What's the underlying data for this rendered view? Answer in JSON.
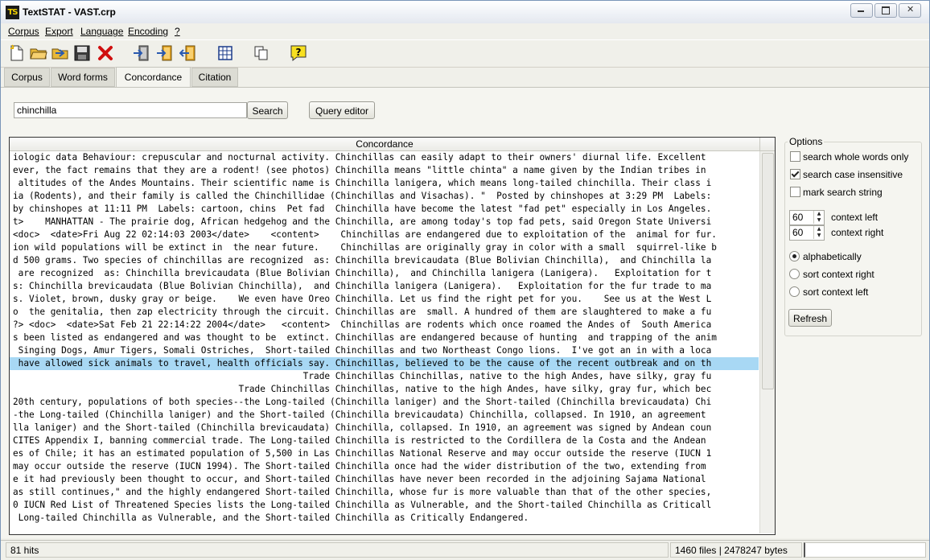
{
  "window": {
    "title": "TextSTAT - VAST.crp",
    "app_icon_text": "TS"
  },
  "menu": [
    "Corpus",
    "Export",
    "Language",
    "Encoding",
    "?"
  ],
  "toolbar": {
    "icons": [
      "new-corpus-icon",
      "open-corpus-icon",
      "open-folder-icon",
      "save-corpus-icon",
      "delete-icon",
      "add-file-icon",
      "add-web-icon",
      "remove-file-icon",
      "grid-icon",
      "copy-icon",
      "help-icon"
    ]
  },
  "tabs": [
    {
      "label": "Corpus",
      "active": false
    },
    {
      "label": "Word forms",
      "active": false
    },
    {
      "label": "Concordance",
      "active": true
    },
    {
      "label": "Citation",
      "active": false
    }
  ],
  "search": {
    "value": "chinchilla",
    "search_label": "Search",
    "query_editor_label": "Query editor"
  },
  "concordance": {
    "header": "Concordance",
    "selected_row": 16,
    "rows": [
      "iologic data Behaviour: crepuscular and nocturnal activity. Chinchillas can easily adapt to their owners' diurnal life. Excellent",
      "ever, the fact remains that they are a rodent! (see photos) Chinchilla means \"little chinta\" a name given by the Indian tribes in",
      " altitudes of the Andes Mountains. Their scientific name is Chinchilla lanigera, which means long-tailed chinchilla. Their class i",
      "ia (Rodents), and their family is called the Chinchillidae (Chinchillas and Visachas). \"  Posted by chinshopes at 3:29 PM  Labels:",
      "by chinshopes at 11:11 PM  Labels: cartoon, chins  Pet fad  Chinchilla have become the latest \"fad pet\" especially in Los Angeles.",
      "t>    MANHATTAN - The prairie dog, African hedgehog and the Chinchilla, are among today's top fad pets, said Oregon State Universi",
      "<doc>  <date>Fri Aug 22 02:14:03 2003</date>    <content>    Chinchillas are endangered due to exploitation of the  animal for fur.",
      "ion wild populations will be extinct in  the near future.    Chinchillas are originally gray in color with a small  squirrel-like b",
      "d 500 grams. Two species of chinchillas are recognized  as: Chinchilla brevicaudata (Blue Bolivian Chinchilla),  and Chinchilla la",
      " are recognized  as: Chinchilla brevicaudata (Blue Bolivian Chinchilla),  and Chinchilla lanigera (Lanigera).   Exploitation for t",
      "s: Chinchilla brevicaudata (Blue Bolivian Chinchilla),  and Chinchilla lanigera (Lanigera).   Exploitation for the fur trade to ma",
      "s. Violet, brown, dusky gray or beige.    We even have Oreo Chinchilla. Let us find the right pet for you.    See us at the West L",
      "o  the genitalia, then zap electricity through the circuit. Chinchillas are  small. A hundred of them are slaughtered to make a fu",
      "?> <doc>  <date>Sat Feb 21 22:14:22 2004</date>   <content>  Chinchillas are rodents which once roamed the Andes of  South America",
      "s been listed as endangered and was thought to be  extinct. Chinchillas are endangered because of hunting  and trapping of the anim",
      " Singing Dogs, Amur Tigers, Somali Ostriches,  Short-tailed Chinchillas and two Northeast Congo lions.  I've got an in with a loca",
      " have allowed sick animals to travel, health officials say. Chinchillas, believed to be the cause of the recent outbreak and on th",
      "                                                      Trade Chinchillas Chinchillas, native to the high Andes, have silky, gray fu",
      "                                          Trade Chinchillas Chinchillas, native to the high Andes, have silky, gray fur, which bec",
      "20th century, populations of both species--the Long-tailed (Chinchilla laniger) and the Short-tailed (Chinchilla brevicaudata) Chi",
      "-the Long-tailed (Chinchilla laniger) and the Short-tailed (Chinchilla brevicaudata) Chinchilla, collapsed. In 1910, an agreement",
      "lla laniger) and the Short-tailed (Chinchilla brevicaudata) Chinchilla, collapsed. In 1910, an agreement was signed by Andean coun",
      "CITES Appendix I, banning commercial trade. The Long-tailed Chinchilla is restricted to the Cordillera de la Costa and the Andean",
      "es of Chile; it has an estimated population of 5,500 in Las Chinchillas National Reserve and may occur outside the reserve (IUCN 1",
      "may occur outside the reserve (IUCN 1994). The Short-tailed Chinchilla once had the wider distribution of the two, extending from",
      "e it had previously been thought to occur, and Short-tailed Chinchillas have never been recorded in the adjoining Sajama National",
      "as still continues,\" and the highly endangered Short-tailed Chinchilla, whose fur is more valuable than that of the other species,",
      "0 IUCN Red List of Threatened Species lists the Long-tailed Chinchilla as Vulnerable, and the Short-tailed Chinchilla as Criticall",
      " Long-tailed Chinchilla as Vulnerable, and the Short-tailed Chinchilla as Critically Endangered."
    ]
  },
  "options": {
    "title": "Options",
    "checkboxes": [
      {
        "label": "search whole words only",
        "checked": false
      },
      {
        "label": "search case insensitive",
        "checked": true
      },
      {
        "label": "mark search string",
        "checked": false
      }
    ],
    "context_left": {
      "value": "60",
      "label": "context left"
    },
    "context_right": {
      "value": "60",
      "label": "context right"
    },
    "sort": [
      {
        "label": "alphabetically",
        "checked": true
      },
      {
        "label": "sort context right",
        "checked": false
      },
      {
        "label": "sort context left",
        "checked": false
      }
    ],
    "refresh_label": "Refresh"
  },
  "status": {
    "hits": "81 hits",
    "files": "1460 files | 2478247 bytes"
  }
}
